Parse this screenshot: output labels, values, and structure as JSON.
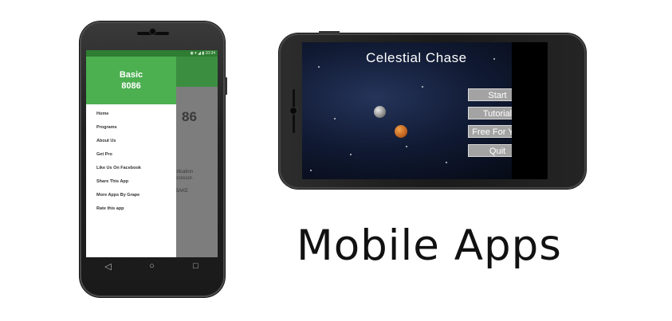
{
  "portrait_app": {
    "status_time": "10:34",
    "drawer_title_line1": "Basic",
    "drawer_title_line2": "8086",
    "background_title": "86",
    "background_line1": "plication",
    "background_line2": "ocessor.",
    "background_line3": "BAKE",
    "menu": [
      "Home",
      "Programs",
      "About Us",
      "Get Pro",
      "Like Us On Facebook",
      "Share This App",
      "More Apps By Grape",
      "Rate this app"
    ],
    "nav": {
      "back": "◁",
      "home": "○",
      "recent": "□"
    },
    "colors": {
      "drawer_header": "#4caf50",
      "status_bar": "#2e7d32"
    }
  },
  "game_app": {
    "title": "Celestial Chase",
    "buttons": [
      "Start",
      "Tutorial",
      "Free For You",
      "Quit"
    ],
    "colors": {
      "button_bg": "#a3a3a3"
    }
  },
  "headline": "Mobile Apps"
}
